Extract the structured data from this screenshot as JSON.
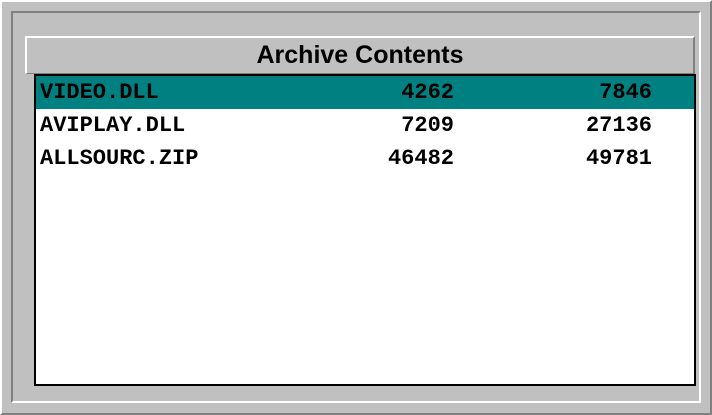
{
  "window": {
    "title": "Archive Contents"
  },
  "colors": {
    "background": "#c0c0c0",
    "selection": "#008080",
    "list_background": "#ffffff"
  },
  "files": [
    {
      "name": "VIDEO.DLL",
      "compressed": "4262",
      "original": "7846",
      "selected": true
    },
    {
      "name": "AVIPLAY.DLL",
      "compressed": "7209",
      "original": "27136",
      "selected": false
    },
    {
      "name": "ALLSOURC.ZIP",
      "compressed": "46482",
      "original": "49781",
      "selected": false
    }
  ]
}
